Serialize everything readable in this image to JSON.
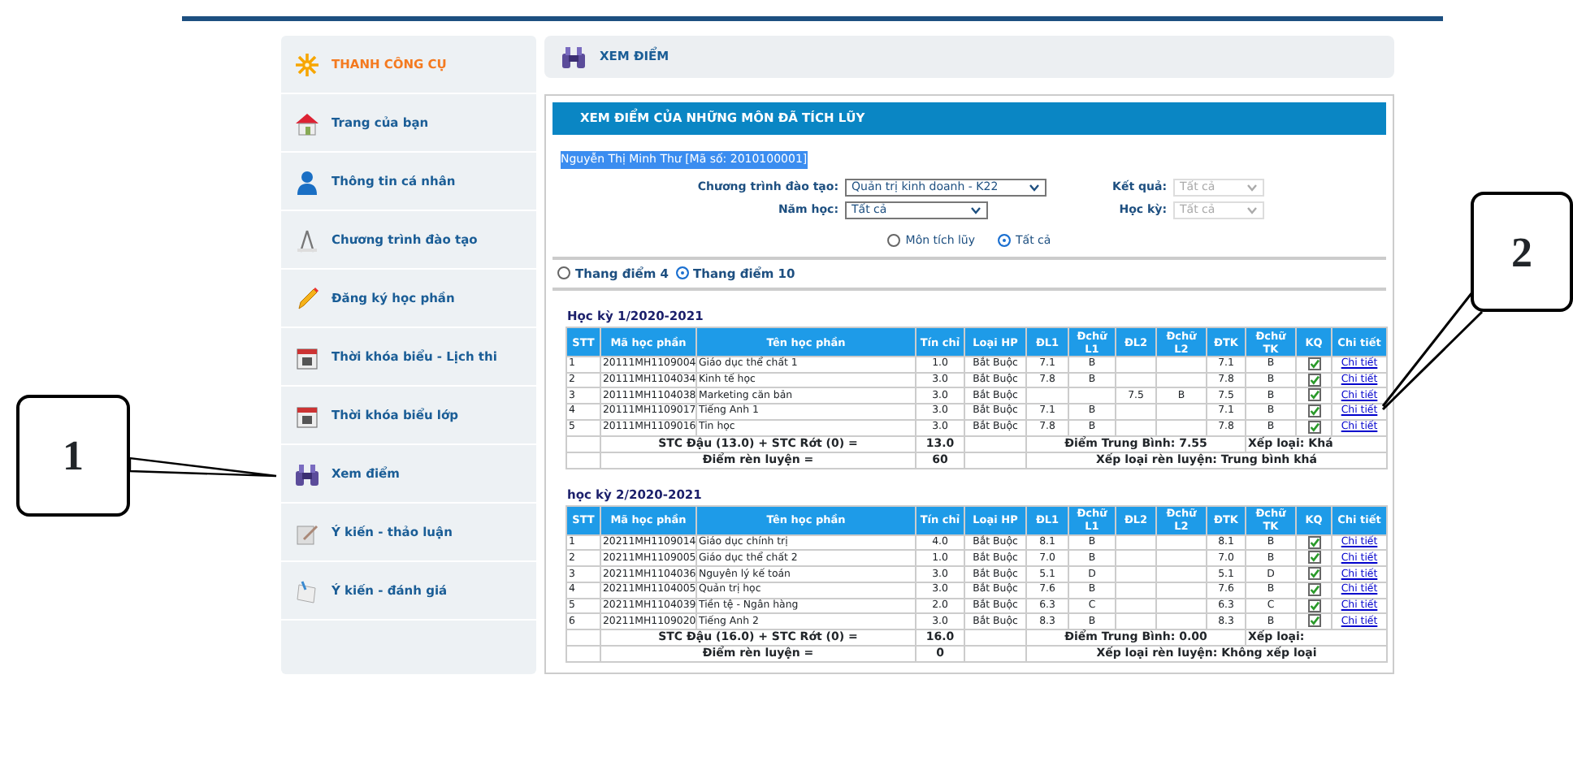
{
  "sidebar": {
    "header": "THANH CÔNG CỤ",
    "items": [
      {
        "label": "Trang của bạn",
        "kind": "home"
      },
      {
        "label": "Thông tin cá nhân",
        "kind": "person"
      },
      {
        "label": "Chương trình đào tạo",
        "kind": "compass"
      },
      {
        "label": "Đăng ký học phần",
        "kind": "pencil"
      },
      {
        "label": "Thời khóa biểu - Lịch thi",
        "kind": "calendar"
      },
      {
        "label": "Thời khóa biểu lớp",
        "kind": "calendar"
      },
      {
        "label": "Xem điểm",
        "kind": "binoculars"
      },
      {
        "label": "Ý kiến - thảo luận",
        "kind": "note"
      },
      {
        "label": "Ý kiến - đánh giá",
        "kind": "paper"
      }
    ]
  },
  "page_header": {
    "title": "XEM ĐIỂM"
  },
  "panel": {
    "title": "XEM ĐIỂM CỦA NHỮNG MÔN ĐÃ TÍCH LŨY",
    "student": {
      "text": "Nguyễn Thị Minh Thư [Mã số: 2010100001]",
      "highlighted": true
    },
    "filters": [
      {
        "label": "Chương trình đào tạo:",
        "value": "Quản trị kinh doanh - K22",
        "disabled": false
      },
      {
        "label": "Kết quả:",
        "value": "Tất cả",
        "disabled": true
      },
      {
        "label": "Năm học:",
        "value": "Tất cả",
        "disabled": false
      },
      {
        "label": "Học kỳ:",
        "value": "Tất cả",
        "disabled": true
      }
    ],
    "result_options": [
      {
        "label": "Môn tích lũy",
        "selected": false
      },
      {
        "label": "Tất cả",
        "selected": true
      }
    ],
    "scale_options": [
      {
        "label": "Thang điểm 4",
        "selected": false
      },
      {
        "label": "Thang điểm 10",
        "selected": true
      }
    ],
    "semesters": [
      {
        "title": "Học kỳ 1/2020-2021",
        "columns": [
          "STT",
          "Mã học phần",
          "Tên học phần",
          "Tín chỉ",
          "Loại HP",
          "ĐL1",
          "Đchữ L1",
          "ĐL2",
          "Đchữ L2",
          "ĐTK",
          "Đchữ TK",
          "KQ",
          "Chi tiết"
        ],
        "rows": [
          {
            "cells": [
              "1",
              "20111MH1109004",
              "Giáo dục thể chất 1",
              "1.0",
              "Bắt Buộc",
              "7.1",
              "B",
              "",
              "",
              "7.1",
              "B"
            ],
            "passed": true,
            "link": "Chi tiết"
          },
          {
            "cells": [
              "2",
              "20111MH1104034",
              "Kinh tế học",
              "3.0",
              "Bắt Buộc",
              "7.8",
              "B",
              "",
              "",
              "7.8",
              "B"
            ],
            "passed": true,
            "link": "Chi tiết"
          },
          {
            "cells": [
              "3",
              "20111MH1104038",
              "Marketing căn bản",
              "3.0",
              "Bắt Buộc",
              "",
              "",
              "7.5",
              "B",
              "7.5",
              "B"
            ],
            "passed": true,
            "link": "Chi tiết"
          },
          {
            "cells": [
              "4",
              "20111MH1109017",
              "Tiếng Anh 1",
              "3.0",
              "Bắt Buộc",
              "7.1",
              "B",
              "",
              "",
              "7.1",
              "B"
            ],
            "passed": true,
            "link": "Chi tiết"
          },
          {
            "cells": [
              "5",
              "20111MH1109016",
              "Tin học",
              "3.0",
              "Bắt Buộc",
              "7.8",
              "B",
              "",
              "",
              "7.8",
              "B"
            ],
            "passed": true,
            "link": "Chi tiết"
          }
        ],
        "credits_label": "STC Đậu (13.0) + STC Rớt (0) =",
        "credits": "13.0",
        "average": "Điểm Trung Bình: 7.55",
        "rank": "Xếp loại: Khá",
        "conduct_label": "Điểm rèn luyện =",
        "conduct": "60",
        "conduct_rank": "Xếp loại rèn luyện: Trung bình khá"
      },
      {
        "title": "học kỳ 2/2020-2021",
        "columns": [
          "STT",
          "Mã học phần",
          "Tên học phần",
          "Tín chỉ",
          "Loại HP",
          "ĐL1",
          "Đchữ L1",
          "ĐL2",
          "Đchữ L2",
          "ĐTK",
          "Đchữ TK",
          "KQ",
          "Chi tiết"
        ],
        "rows": [
          {
            "cells": [
              "1",
              "20211MH1109014",
              "Giáo dục chính trị",
              "4.0",
              "Bắt Buộc",
              "8.1",
              "B",
              "",
              "",
              "8.1",
              "B"
            ],
            "passed": true,
            "link": "Chi tiết"
          },
          {
            "cells": [
              "2",
              "20211MH1109005",
              "Giáo dục thể chất 2",
              "1.0",
              "Bắt Buộc",
              "7.0",
              "B",
              "",
              "",
              "7.0",
              "B"
            ],
            "passed": true,
            "link": "Chi tiết"
          },
          {
            "cells": [
              "3",
              "20211MH1104036",
              "Nguyên lý kế toán",
              "3.0",
              "Bắt Buộc",
              "5.1",
              "D",
              "",
              "",
              "5.1",
              "D"
            ],
            "passed": true,
            "link": "Chi tiết"
          },
          {
            "cells": [
              "4",
              "20211MH1104005",
              "Quản trị học",
              "3.0",
              "Bắt Buộc",
              "7.6",
              "B",
              "",
              "",
              "7.6",
              "B"
            ],
            "passed": true,
            "link": "Chi tiết"
          },
          {
            "cells": [
              "5",
              "20211MH1104039",
              "Tiền tệ - Ngân hàng",
              "2.0",
              "Bắt Buộc",
              "6.3",
              "C",
              "",
              "",
              "6.3",
              "C"
            ],
            "passed": true,
            "link": "Chi tiết"
          },
          {
            "cells": [
              "6",
              "20211MH1109020",
              "Tiếng Anh 2",
              "3.0",
              "Bắt Buộc",
              "8.3",
              "B",
              "",
              "",
              "8.3",
              "B"
            ],
            "passed": true,
            "link": "Chi tiết"
          }
        ],
        "credits_label": "STC Đậu (16.0) + STC Rớt (0) =",
        "credits": "16.0",
        "average": "Điểm Trung Bình: 0.00",
        "rank": "Xếp loại:",
        "conduct_label": "Điểm rèn luyện =",
        "conduct": "0",
        "conduct_rank": "Xếp loại rèn luyện: Không xếp loại"
      }
    ]
  },
  "callouts": [
    {
      "label": "1"
    },
    {
      "label": "2"
    }
  ]
}
